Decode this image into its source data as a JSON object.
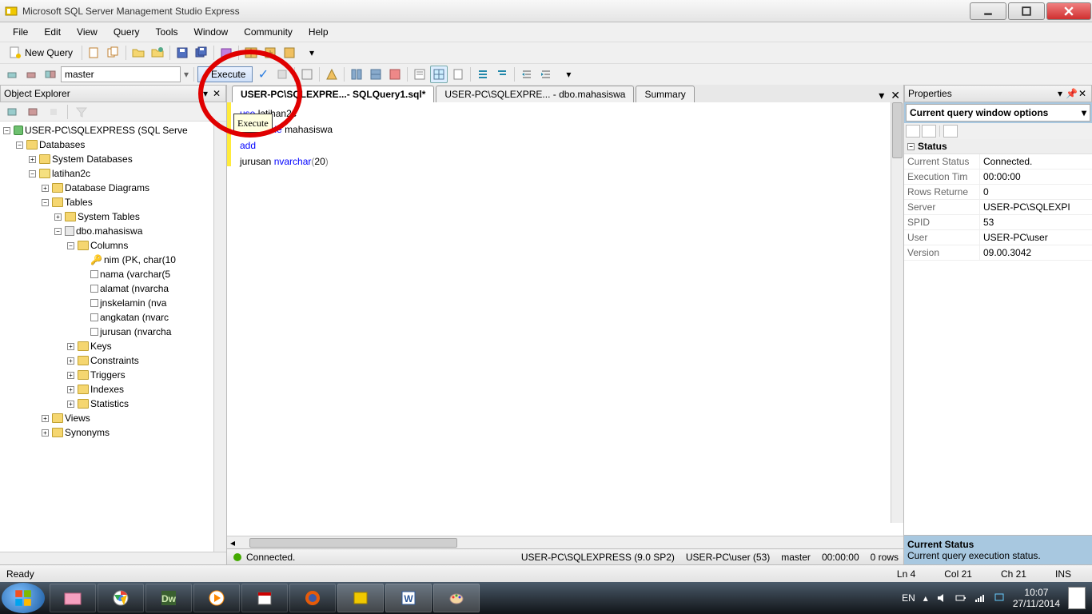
{
  "window": {
    "title": "Microsoft SQL Server Management Studio Express"
  },
  "menu": [
    "File",
    "Edit",
    "View",
    "Query",
    "Tools",
    "Window",
    "Community",
    "Help"
  ],
  "toolbar1": {
    "newQuery": "New Query"
  },
  "toolbar2": {
    "dbCombo": "master",
    "execute": "Execute",
    "tooltip": "Execute"
  },
  "objectExplorer": {
    "title": "Object Explorer",
    "root": "USER-PC\\SQLEXPRESS (SQL Serve",
    "databases": "Databases",
    "sysdb": "System Databases",
    "latihan": "latihan2c",
    "diagrams": "Database Diagrams",
    "tables": "Tables",
    "systables": "System Tables",
    "dbotbl": "dbo.mahasiswa",
    "columns": "Columns",
    "cols": [
      "nim (PK, char(10",
      "nama (varchar(5",
      "alamat (nvarcha",
      "jnskelamin (nva",
      "angkatan (nvarc",
      "jurusan (nvarcha"
    ],
    "folders": [
      "Keys",
      "Constraints",
      "Triggers",
      "Indexes",
      "Statistics"
    ],
    "views": "Views",
    "synonyms": "Synonyms"
  },
  "tabs": {
    "t1": "USER-PC\\SQLEXPRE...- SQLQuery1.sql*",
    "t2": "USER-PC\\SQLEXPRE... - dbo.mahasiswa",
    "t3": "Summary"
  },
  "sql": {
    "l1a": "use",
    "l1b": "latihan2c",
    "l2a": "alter",
    "l2b": "table",
    "l2c": "mahasiswa",
    "l3": "add",
    "l4a": "jurusan ",
    "l4b": "nvarchar",
    "l4c": "(",
    "l4d": "20",
    "l4e": ")"
  },
  "edStatus": {
    "connected": "Connected.",
    "server": "USER-PC\\SQLEXPRESS (9.0 SP2)",
    "user": "USER-PC\\user (53)",
    "db": "master",
    "time": "00:00:00",
    "rows": "0 rows"
  },
  "props": {
    "title": "Properties",
    "combo": "Current query window options",
    "cat": "Status",
    "rows": [
      {
        "k": "Current Status",
        "v": "Connected."
      },
      {
        "k": "Execution Tim",
        "v": "00:00:00"
      },
      {
        "k": "Rows Returne",
        "v": "0"
      },
      {
        "k": "Server",
        "v": "USER-PC\\SQLEXPI"
      },
      {
        "k": "SPID",
        "v": "53"
      },
      {
        "k": "User",
        "v": "USER-PC\\user"
      },
      {
        "k": "Version",
        "v": "09.00.3042"
      }
    ],
    "descTitle": "Current Status",
    "descBody": "Current query execution status."
  },
  "status": {
    "ready": "Ready",
    "ln": "Ln 4",
    "col": "Col 21",
    "ch": "Ch 21",
    "ins": "INS"
  },
  "tray": {
    "lang": "EN",
    "time": "10:07",
    "date": "27/11/2014"
  }
}
